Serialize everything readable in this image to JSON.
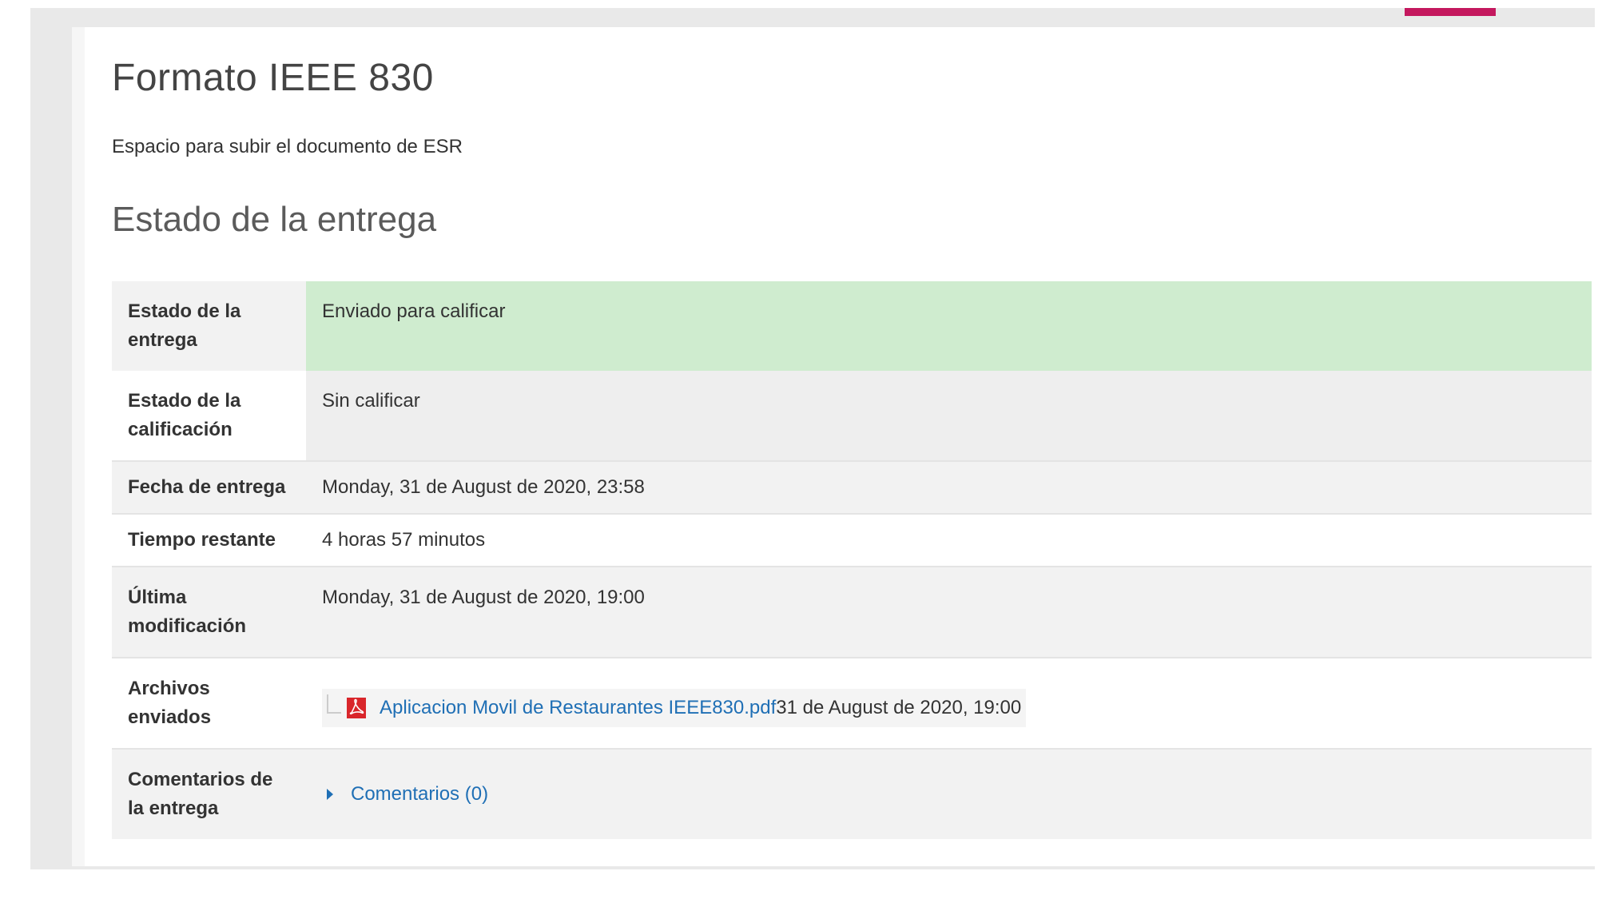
{
  "colors": {
    "accent": "#c4185e",
    "link": "#1f6fb5",
    "submitted_bg": "#cfeccf"
  },
  "page": {
    "title": "Formato IEEE 830",
    "description": "Espacio para subir el documento de ESR"
  },
  "submission_status": {
    "section_title": "Estado de la entrega",
    "rows": [
      {
        "label": "Estado de la entrega",
        "value": "Enviado para calificar"
      },
      {
        "label": "Estado de la calificación",
        "value": "Sin calificar"
      },
      {
        "label": "Fecha de entrega",
        "value": "Monday, 31 de August de 2020, 23:58"
      },
      {
        "label": "Tiempo restante",
        "value": "4 horas 57 minutos"
      },
      {
        "label": "Última modificación",
        "value": "Monday, 31 de August de 2020, 19:00"
      },
      {
        "label": "Archivos enviados",
        "file": {
          "name": "Aplicacion Movil de Restaurantes IEEE830.pdf",
          "date": "31 de August de 2020, 19:00",
          "icon": "pdf-icon"
        }
      },
      {
        "label": "Comentarios de la entrega",
        "link": {
          "text": "Comentarios (0)",
          "icon": "caret-right-icon"
        }
      }
    ]
  }
}
